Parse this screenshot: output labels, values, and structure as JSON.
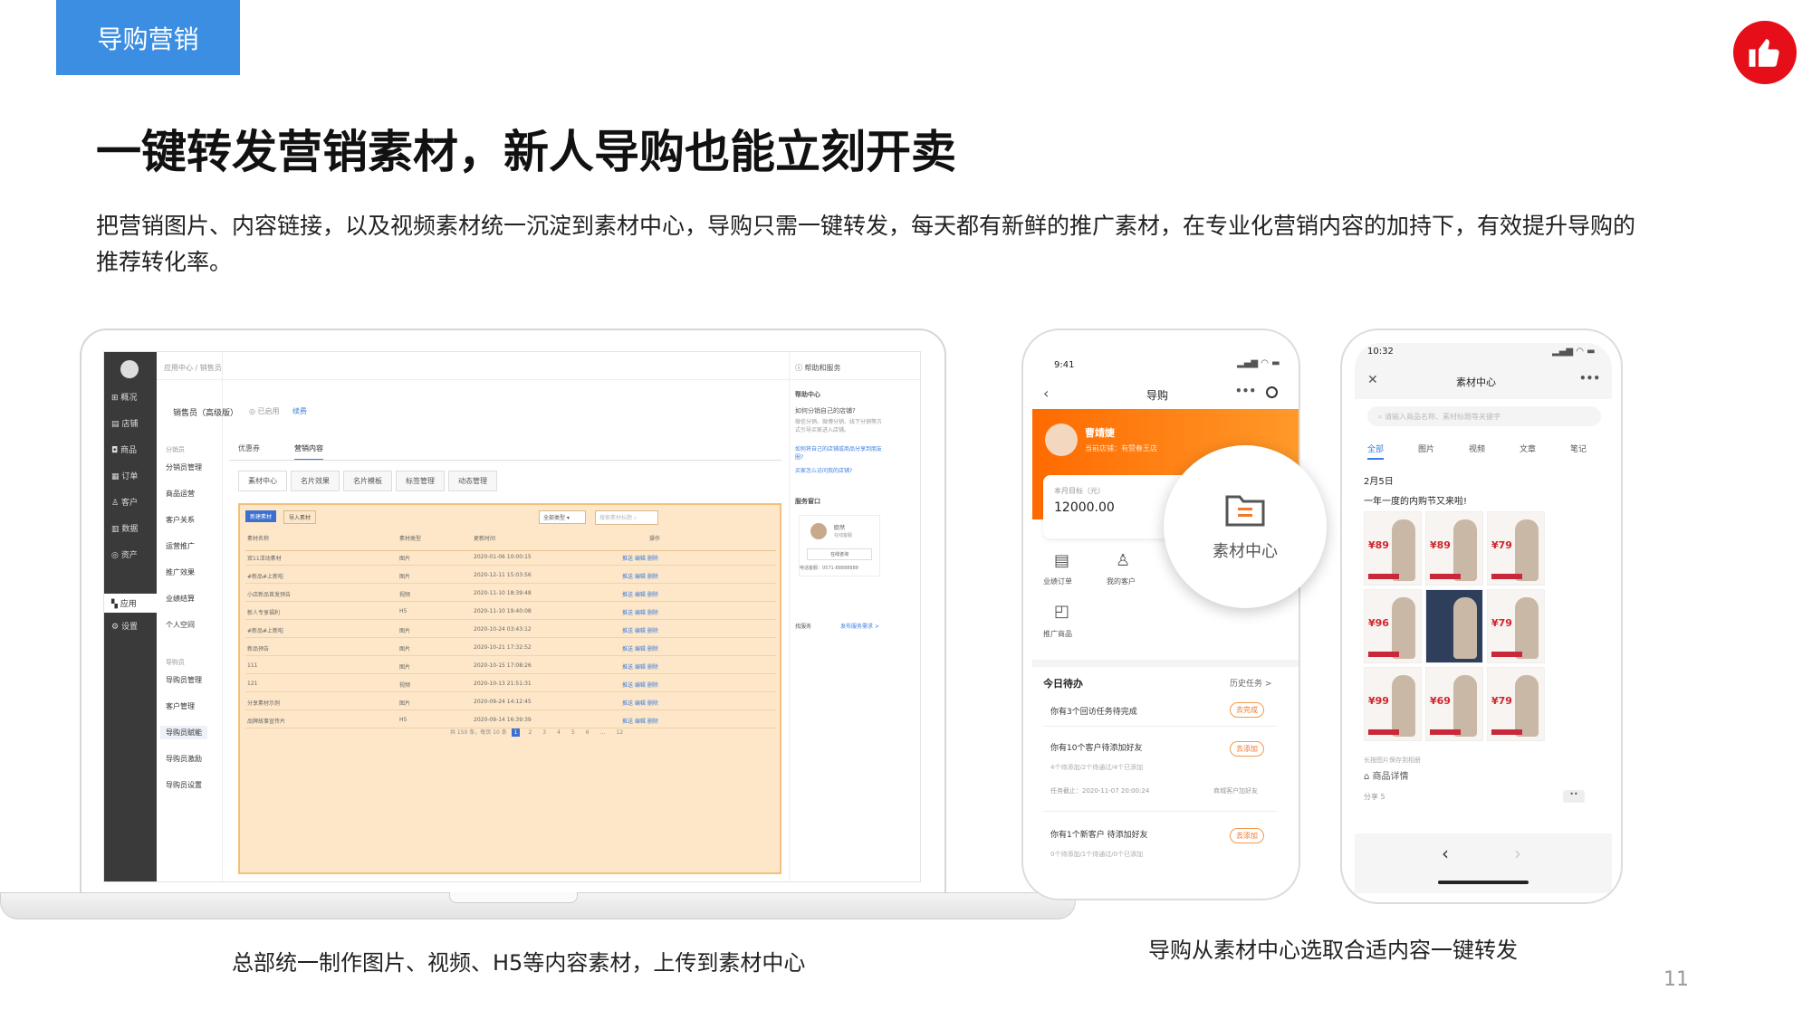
{
  "tag": "导购营销",
  "title": "一键转发营销素材，新人导购也能立刻开卖",
  "description": "把营销图片、内容链接，以及视频素材统一沉淀到素材中心，导购只需一键转发，每天都有新鲜的推广素材，在专业化营销内容的加持下，有效提升导购的推荐转化率。",
  "caption_left": "总部统一制作图片、视频、H5等内容素材，上传到素材中心",
  "caption_right": "导购从素材中心选取合适内容一键转发",
  "page_number": "11",
  "colors": {
    "tag_bg": "#3b8ee2",
    "logo": "#e60e19",
    "orange": "#ff7a1a"
  },
  "laptop": {
    "sidebar": [
      "概况",
      "店铺",
      "商品",
      "订单",
      "客户",
      "数据",
      "资产",
      "应用",
      "设置"
    ],
    "breadcrumb": "应用中心 / 销售员",
    "product_title": "销售员（高级版）",
    "status": "已启用",
    "renew": "续费",
    "help_link": "帮助和服务",
    "sub_menu": [
      {
        "label": "分销员",
        "group": true
      },
      {
        "label": "分销员管理"
      },
      {
        "label": "商品运营"
      },
      {
        "label": "客户关系"
      },
      {
        "label": "运营推广"
      },
      {
        "label": "推广效果"
      },
      {
        "label": "业绩结算"
      },
      {
        "label": "个人空间"
      },
      {
        "label": "导购员",
        "group": true
      },
      {
        "label": "导购员管理"
      },
      {
        "label": "客户管理"
      },
      {
        "label": "导购员赋能",
        "active": true
      },
      {
        "label": "导购员激励"
      },
      {
        "label": "导购员设置"
      }
    ],
    "tabs": [
      "优惠券",
      "营销内容"
    ],
    "sub_tabs": [
      "素材中心",
      "名片效果",
      "名片模板",
      "标签管理",
      "动态管理"
    ],
    "btn_new": "新建素材",
    "btn_import": "导入素材",
    "filter": "全部类型",
    "search_placeholder": "搜索素材标题",
    "columns": [
      "素材名称",
      "素材类型",
      "更新时间",
      "操作"
    ],
    "rows": [
      [
        "双11活动素材",
        "图片",
        "2020-01-06 10:00:15"
      ],
      [
        "#新品#上新啦",
        "图片",
        "2020-12-11 15:03:56"
      ],
      [
        "小店新品首发预告",
        "视频",
        "2020-11-10 18:39:48"
      ],
      [
        "新人专享福利",
        "H5",
        "2020-11-10 19:40:08"
      ],
      [
        "#新品#上新啦",
        "图片",
        "2020-10-24 03:43:12"
      ],
      [
        "新品预告",
        "图片",
        "2020-10-21 17:32:52"
      ],
      [
        "111",
        "图片",
        "2020-10-15 17:08:26"
      ],
      [
        "121",
        "视频",
        "2020-10-13 21:51:31"
      ],
      [
        "分享素材示例",
        "图片",
        "2020-09-24 14:12:45"
      ],
      [
        "品牌故事宣传片",
        "H5",
        "2020-09-14 16:39:39"
      ]
    ],
    "row_actions": "推送 编辑 删除",
    "pagination": "共 150 条，每页 10 条",
    "pages": [
      "1",
      "2",
      "3",
      "4",
      "5",
      "6",
      "…",
      "12"
    ],
    "help": {
      "title": "帮助中心",
      "q1": "如何分销自己的店铺?",
      "a1": "微信分销、微博分销、线下分销等方式引导买家进入店铺。",
      "q2": "如何将自己的店铺或商品分享到朋友圈?",
      "q3": "买家怎么访问我的店铺?",
      "service_title": "服务窗口",
      "agent_name": "欧然",
      "agent_role": "在线客服",
      "online_btn": "在线咨询",
      "phone": "电话客服：0571-88888888",
      "find_service": "找服务",
      "post_request": "发布服务需求 >"
    }
  },
  "phone1": {
    "time": "9:41",
    "title": "导购",
    "user_name": "曹靖婕",
    "user_sub": "当前店铺：有赞春王店",
    "target_label": "本月目标（元）",
    "target_value": "12000.00",
    "entries": [
      "业绩订单",
      "我的客户",
      "推广商品"
    ],
    "bubble_label": "素材中心",
    "todo_title": "今日待办",
    "todo_history": "历史任务 >",
    "tasks": [
      {
        "text": "你有3个回访任务待完成",
        "btn": "去完成"
      },
      {
        "text": "你有10个客户待添加好友",
        "detail": "4个待添加/2个待通过/4个已添加",
        "deadline": "任务截止：2020-11-07 20:00:24",
        "scope": "商城客户加好友",
        "btn": "去添加"
      },
      {
        "text": "你有1个新客户 待添加好友",
        "detail": "0个待添加/1个待通过/0个已添加",
        "btn": "去添加"
      }
    ]
  },
  "phone2": {
    "time": "10:32",
    "title": "素材中心",
    "search_placeholder": "请输入商品名称、素材标题等关键字",
    "tabs": [
      "全部",
      "图片",
      "视频",
      "文章",
      "笔记"
    ],
    "date": "2月5日",
    "post_text": "一年一度的内购节又来啦!",
    "prices": [
      "¥89",
      "¥89",
      "¥79",
      "¥96",
      "",
      "¥79",
      "¥99",
      "¥69",
      "¥79"
    ],
    "tip": "长按图片保存到相册",
    "product_detail": "商品详情",
    "share": "分享 5",
    "more": "••"
  }
}
